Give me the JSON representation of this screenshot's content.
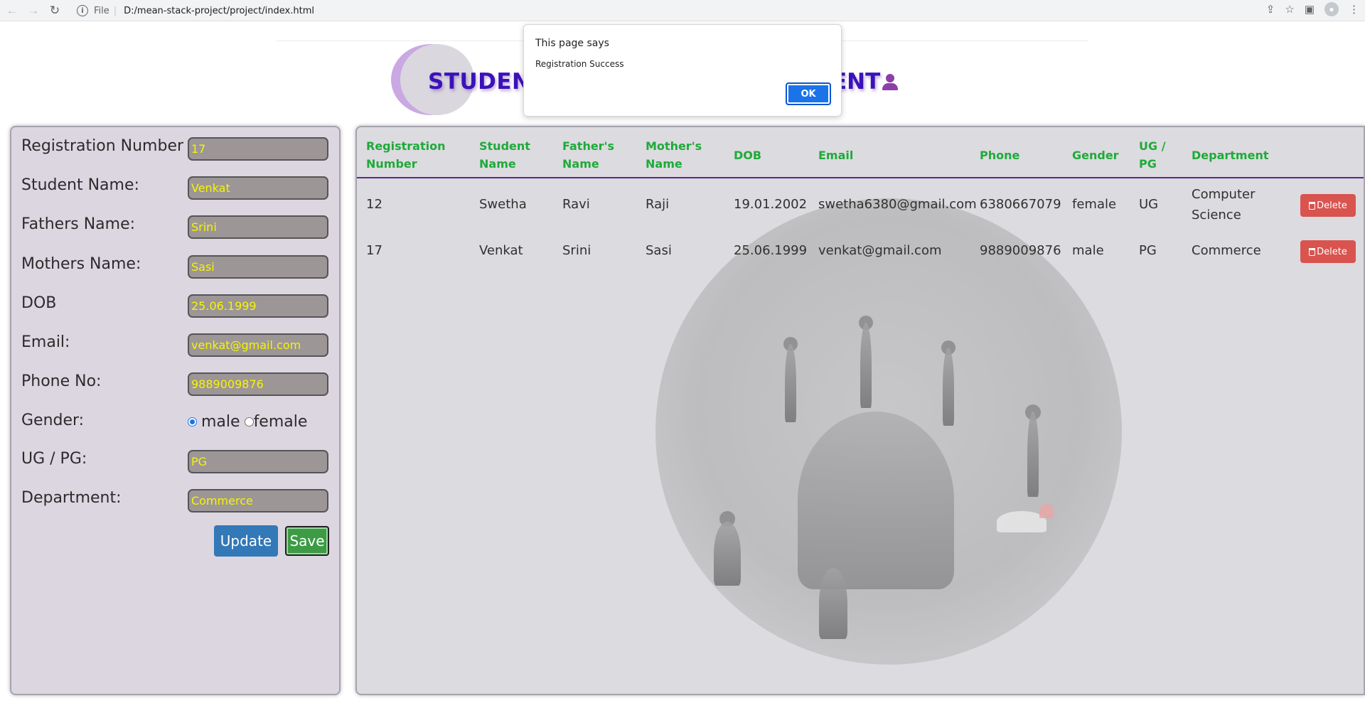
{
  "browser": {
    "back_icon": "←",
    "forward_icon": "→",
    "reload_icon": "↻",
    "scheme_label": "File",
    "separator": "|",
    "url": "D:/mean-stack-project/project/index.html"
  },
  "header": {
    "title_left": "STUDEN",
    "title_right": "ENT"
  },
  "alert": {
    "title": "This page says",
    "message": "Registration Success",
    "ok_label": "OK"
  },
  "form": {
    "fields": [
      {
        "label": "Registration Number",
        "value": "17"
      },
      {
        "label": "Student Name:",
        "value": "Venkat"
      },
      {
        "label": "Fathers Name:",
        "value": "Srini"
      },
      {
        "label": "Mothers Name:",
        "value": "Sasi"
      },
      {
        "label": "DOB",
        "value": "25.06.1999"
      },
      {
        "label": "Email:",
        "value": "venkat@gmail.com"
      },
      {
        "label": "Phone No:",
        "value": "9889009876"
      }
    ],
    "gender": {
      "label": "Gender:",
      "option_male": "male",
      "option_female": "female",
      "selected": "male"
    },
    "ugpg": {
      "label": "UG / PG:",
      "value": "PG"
    },
    "department": {
      "label": "Department:",
      "value": "Commerce"
    },
    "update_label": "Update",
    "save_label": "Save"
  },
  "table": {
    "headers": [
      "Registration Number",
      "Student Name",
      "Father's Name",
      "Mother's Name",
      "DOB",
      "Email",
      "Phone",
      "Gender",
      "UG / PG",
      "Department"
    ],
    "rows": [
      {
        "reg": "12",
        "name": "Swetha",
        "father": "Ravi",
        "mother": "Raji",
        "dob": "19.01.2002",
        "email": "swetha6380@gmail.com",
        "phone": "6380667079",
        "gender": "female",
        "ugpg": "UG",
        "dept": "Computer Science"
      },
      {
        "reg": "17",
        "name": "Venkat",
        "father": "Srini",
        "mother": "Sasi",
        "dob": "25.06.1999",
        "email": "venkat@gmail.com",
        "phone": "9889009876",
        "gender": "male",
        "ugpg": "PG",
        "dept": "Commerce"
      }
    ],
    "delete_label": "Delete"
  },
  "colors": {
    "accent": "#3b12b8",
    "header_text": "#1faa3a",
    "input_text": "#f5f500",
    "delete": "#d9534f",
    "update": "#3378b7",
    "save": "#3c9b44"
  }
}
